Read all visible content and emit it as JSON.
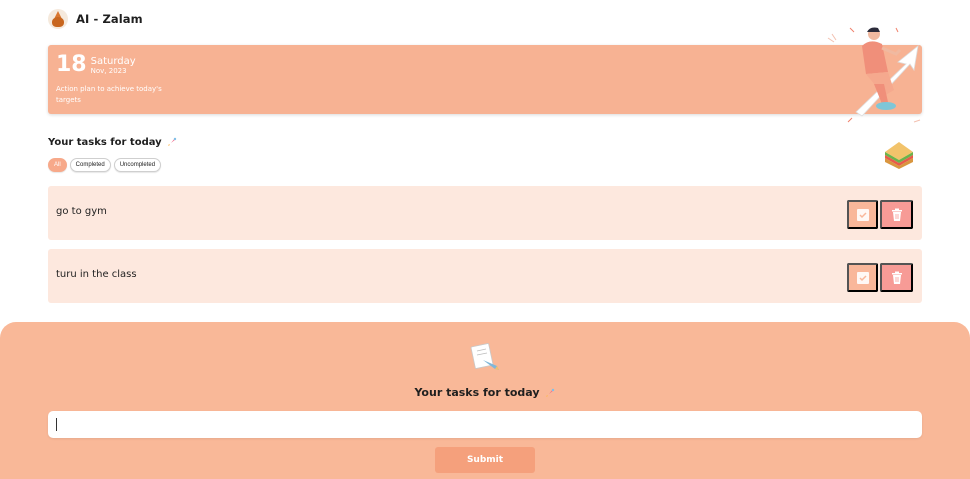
{
  "app": {
    "name": "AI - Zalam"
  },
  "banner": {
    "day": "18",
    "weekday": "Saturday",
    "month_year": "Nov, 2023",
    "tagline": "Action plan to achieve today's targets"
  },
  "tasks_section": {
    "title": "Your tasks for today",
    "filters": [
      {
        "label": "All",
        "active": true
      },
      {
        "label": "Completed",
        "active": false
      },
      {
        "label": "Uncompleted",
        "active": false
      }
    ],
    "items": [
      {
        "text": "go to gym"
      },
      {
        "text": "turu in the class"
      }
    ]
  },
  "form": {
    "title": "Your tasks for today",
    "input_value": "",
    "submit_label": "Submit"
  },
  "colors": {
    "banner": "#f7b293",
    "task_bg": "#fde8de",
    "check_btn": "#f9b79a",
    "delete_btn": "#f79b96",
    "footer_bg": "#f9b898",
    "submit_btn": "#f5a07c"
  },
  "icons": {
    "logo": "fox-avatar-icon",
    "title_emoji": "rocket-icon",
    "decoration": "sandwich-icon",
    "complete": "check-icon",
    "delete": "trash-icon",
    "form_emoji": "memo-pencil-icon"
  }
}
